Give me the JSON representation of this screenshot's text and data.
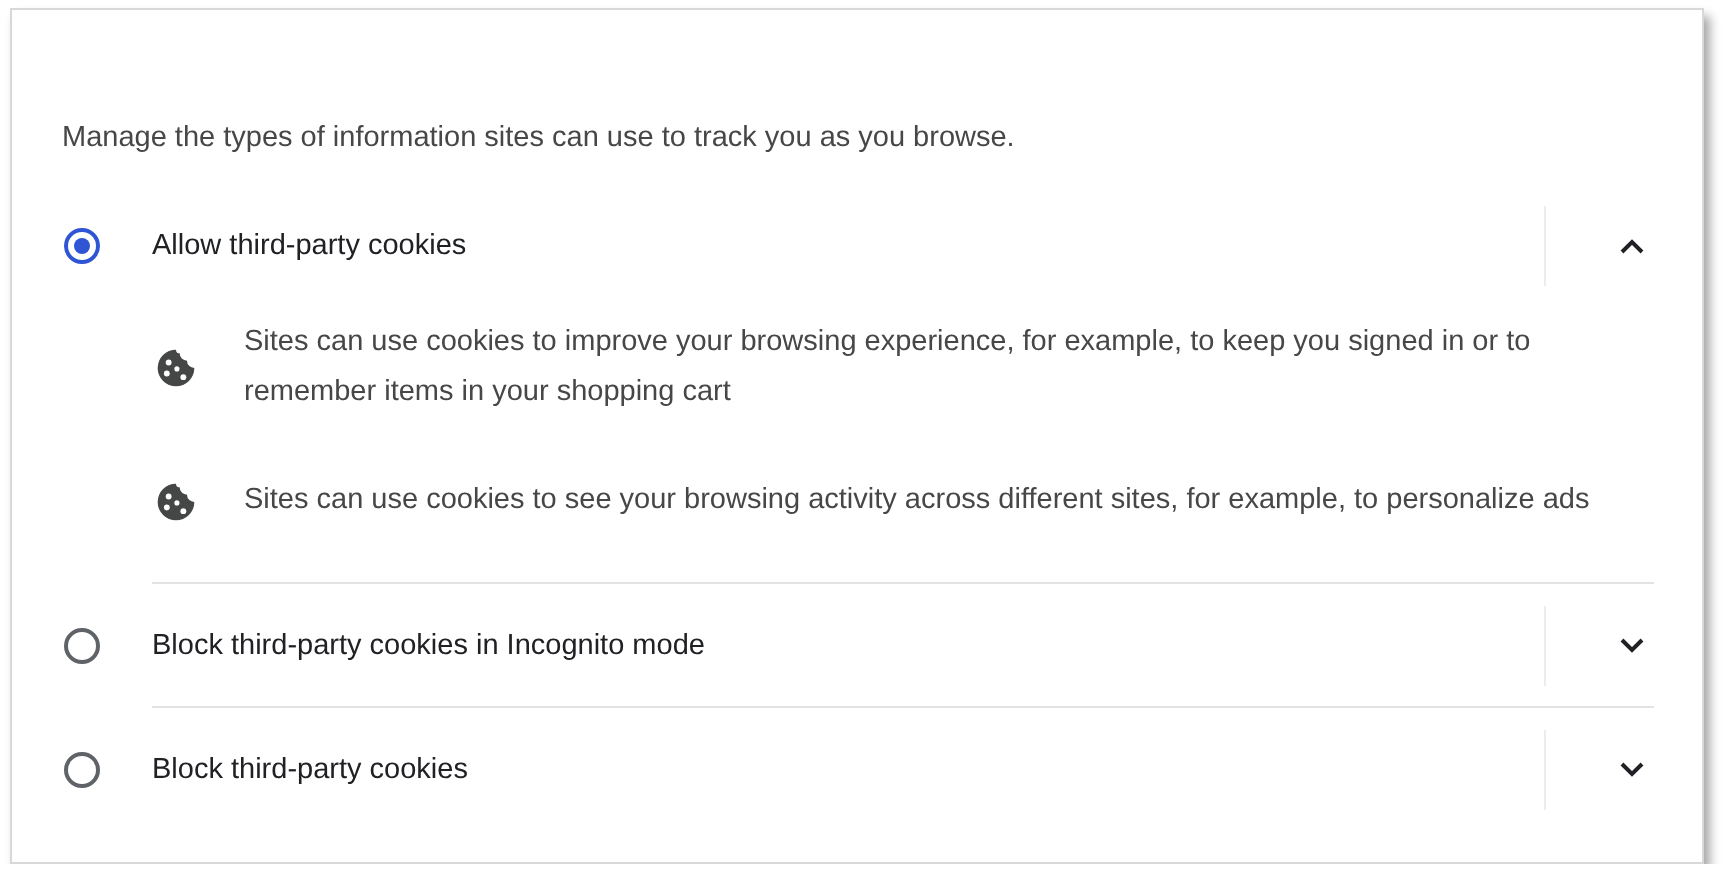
{
  "description": "Manage the types of information sites can use to track you as you browse.",
  "options": [
    {
      "label": "Allow third-party cookies",
      "selected": true,
      "expanded": true,
      "details": [
        "Sites can use cookies to improve your browsing experience, for example, to keep you signed in or to remember items in your shopping cart",
        "Sites can use cookies to see your browsing activity across different sites, for example, to personalize ads"
      ]
    },
    {
      "label": "Block third-party cookies in Incognito mode",
      "selected": false,
      "expanded": false
    },
    {
      "label": "Block third-party cookies",
      "selected": false,
      "expanded": false
    }
  ]
}
